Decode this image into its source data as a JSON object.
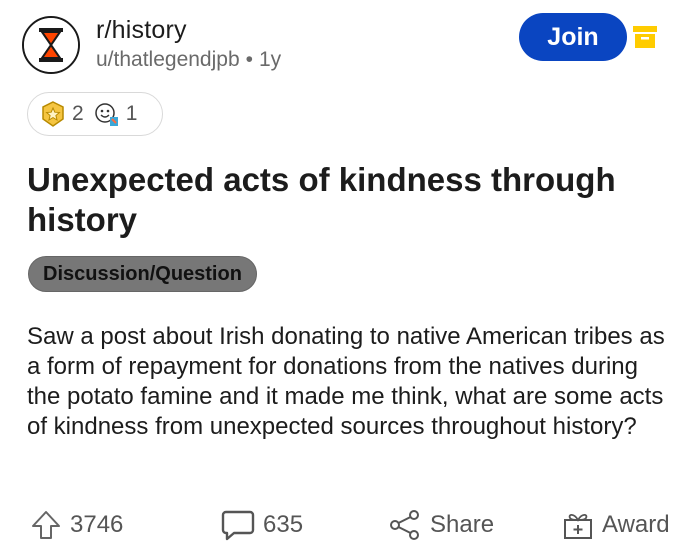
{
  "subreddit": {
    "name": "r/history"
  },
  "post_meta": {
    "author": "u/thatlegendjpb",
    "separator": "•",
    "age": "1y"
  },
  "join_button": {
    "label": "Join"
  },
  "awards": [
    {
      "icon": "star-award-icon",
      "count": "2"
    },
    {
      "icon": "wholesome-award-icon",
      "count": "1"
    }
  ],
  "post": {
    "title": "Unexpected acts of kindness through history",
    "flair": "Discussion/Question",
    "body": "Saw a post about Irish donating to native American tribes as a form of repayment for donations from the natives during the potato famine and it made me think, what are some acts of kindness from unexpected sources throughout history?"
  },
  "actions": {
    "upvote_count": "3746",
    "comment_count": "635",
    "share_label": "Share",
    "award_label": "Award"
  },
  "colors": {
    "join_bg": "#0a45c1",
    "flair_bg": "#777777",
    "archive": "#ffcc00",
    "avatar_accent": "#ff4500"
  }
}
